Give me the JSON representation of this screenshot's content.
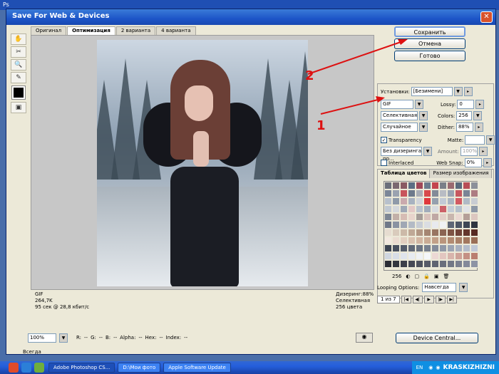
{
  "app_bar": {
    "title": "Ps"
  },
  "dialog": {
    "title": "Save For Web & Devices",
    "close_label": "✕",
    "tabs": [
      {
        "label": "Оригинал",
        "active": false
      },
      {
        "label": "Оптимизация",
        "active": true
      },
      {
        "label": "2 варианта",
        "active": false
      },
      {
        "label": "4 варианта",
        "active": false
      }
    ],
    "tools": [
      {
        "name": "hand-tool-icon",
        "glyph": "✋"
      },
      {
        "name": "slice-select-tool-icon",
        "glyph": "✂"
      },
      {
        "name": "zoom-tool-icon",
        "glyph": "🔍"
      },
      {
        "name": "eyedropper-tool-icon",
        "glyph": "✎"
      }
    ],
    "image_info": {
      "left": [
        "GIF",
        "264,7K",
        "95 сек @ 28,8 кбит/с"
      ],
      "right": [
        "Дизеринг:88%",
        "Селективная",
        "256 цвета"
      ]
    },
    "status": {
      "zoom": "100%",
      "fields": [
        "R:",
        "--",
        "G:",
        "--",
        "B:",
        "--",
        "Alpha:",
        "--",
        "Hex:",
        "--",
        "Index:",
        "--"
      ]
    },
    "buttons": {
      "save": "Сохранить",
      "cancel": "Отмена",
      "done": "Готово",
      "device_central": "Device Central..."
    },
    "settings": {
      "preset_label": "Установки:",
      "preset_value": "[Безимени]",
      "format": "GIF",
      "lossy_label": "Lossy:",
      "lossy_value": "0",
      "reduction": "Селективная",
      "colors_label": "Colors:",
      "colors_value": "256",
      "dither_algo": "Случайное",
      "dither_label": "Dither:",
      "dither_value": "88%",
      "transparency_label": "Transparency",
      "transparency_checked": true,
      "matte_label": "Matte:",
      "trans_dither": "Без дизеринга пр...",
      "amount_label": "Amount:",
      "amount_value": "100%",
      "interlaced_label": "Interlaced",
      "websnap_label": "Web Snap:",
      "websnap_value": "0%"
    },
    "color_table": {
      "tabs": [
        "Таблица цветов",
        "Размер изображения"
      ],
      "count": "256",
      "palette": [
        "#6a6e7a",
        "#7b6870",
        "#8a5a63",
        "#5c6e84",
        "#a04858",
        "#6b7b8d",
        "#c3444e",
        "#7a7f88",
        "#9a6a70",
        "#5a6a7c",
        "#b84e56",
        "#8c909a",
        "#7b8698",
        "#9aa2b0",
        "#c8545c",
        "#6e7a8c",
        "#a9adb6",
        "#d84a4c",
        "#838b98",
        "#b8bcc4",
        "#9aa4b3",
        "#c65860",
        "#7a8596",
        "#ad7c82",
        "#b7c0cc",
        "#8e9aa9",
        "#caa9ad",
        "#a8b2c0",
        "#d0d4da",
        "#e0383c",
        "#95a0ae",
        "#c2cad5",
        "#aab5c2",
        "#d25a62",
        "#b0bac6",
        "#c8ccd2",
        "#c0c8d2",
        "#d4d8dc",
        "#9fa8b6",
        "#e3c8c6",
        "#b9c2cd",
        "#a1acbb",
        "#d8dce0",
        "#cc6068",
        "#c4ccd6",
        "#b4bfcb",
        "#e0e2e6",
        "#8c97a6",
        "#7d8694",
        "#c2b0a8",
        "#d6bcb4",
        "#e8d4cc",
        "#a59c98",
        "#d8c2bc",
        "#bfa8a4",
        "#e2cfc8",
        "#c9b6ae",
        "#ead8d2",
        "#b49e98",
        "#dcc7c0",
        "#6f7888",
        "#8a93a2",
        "#9fa7b4",
        "#b3bac5",
        "#c7ccd4",
        "#dadde2",
        "#e8eaee",
        "#f0f2f4",
        "#5e6676",
        "#4e5666",
        "#3e4654",
        "#2e3440",
        "#e6dcd0",
        "#d9cbbc",
        "#ccb9a8",
        "#bfa896",
        "#b29784",
        "#a58672",
        "#987562",
        "#8b6452",
        "#7e5444",
        "#714438",
        "#64362c",
        "#572a22",
        "#f2e8e0",
        "#eadbd0",
        "#e2cfc0",
        "#dac2b0",
        "#d2b6a2",
        "#caab94",
        "#c2a088",
        "#ba957c",
        "#b28b72",
        "#aa8168",
        "#a2775e",
        "#9a6e56",
        "#3c4452",
        "#48505e",
        "#545c6a",
        "#606876",
        "#6c7482",
        "#78808e",
        "#848c9a",
        "#9098a6",
        "#9ca4b2",
        "#a8b0be",
        "#b4bcca",
        "#c0c8d6",
        "#cfd6e0",
        "#d7dde6",
        "#dfe4ec",
        "#e7ebf1",
        "#eff2f6",
        "#f5f7fa",
        "#ecd8d4",
        "#e2c6c0",
        "#d8b4ac",
        "#cea298",
        "#c49084",
        "#ba7e70",
        "#2a2c34",
        "#33363f",
        "#3c3f49",
        "#454854",
        "#4e525e",
        "#575b68",
        "#606472",
        "#696e7c",
        "#727786",
        "#7b8090",
        "#84899a",
        "#8d93a4"
      ]
    },
    "looping": {
      "label": "Looping Options:",
      "value": "Навсегда"
    },
    "frame_nav": {
      "counter": "1 из 7"
    }
  },
  "annotations": {
    "one": "1",
    "two": "2"
  },
  "taskbar": {
    "tasks": [
      {
        "label": "Adobe Photoshop CS...",
        "active": true
      },
      {
        "label": "D:\\Мои фото",
        "active": false
      },
      {
        "label": "Apple Software Update",
        "active": false
      }
    ],
    "bottom_left": "Всегда",
    "lang": "EN",
    "brand": "KRASKIZHIZNI"
  }
}
